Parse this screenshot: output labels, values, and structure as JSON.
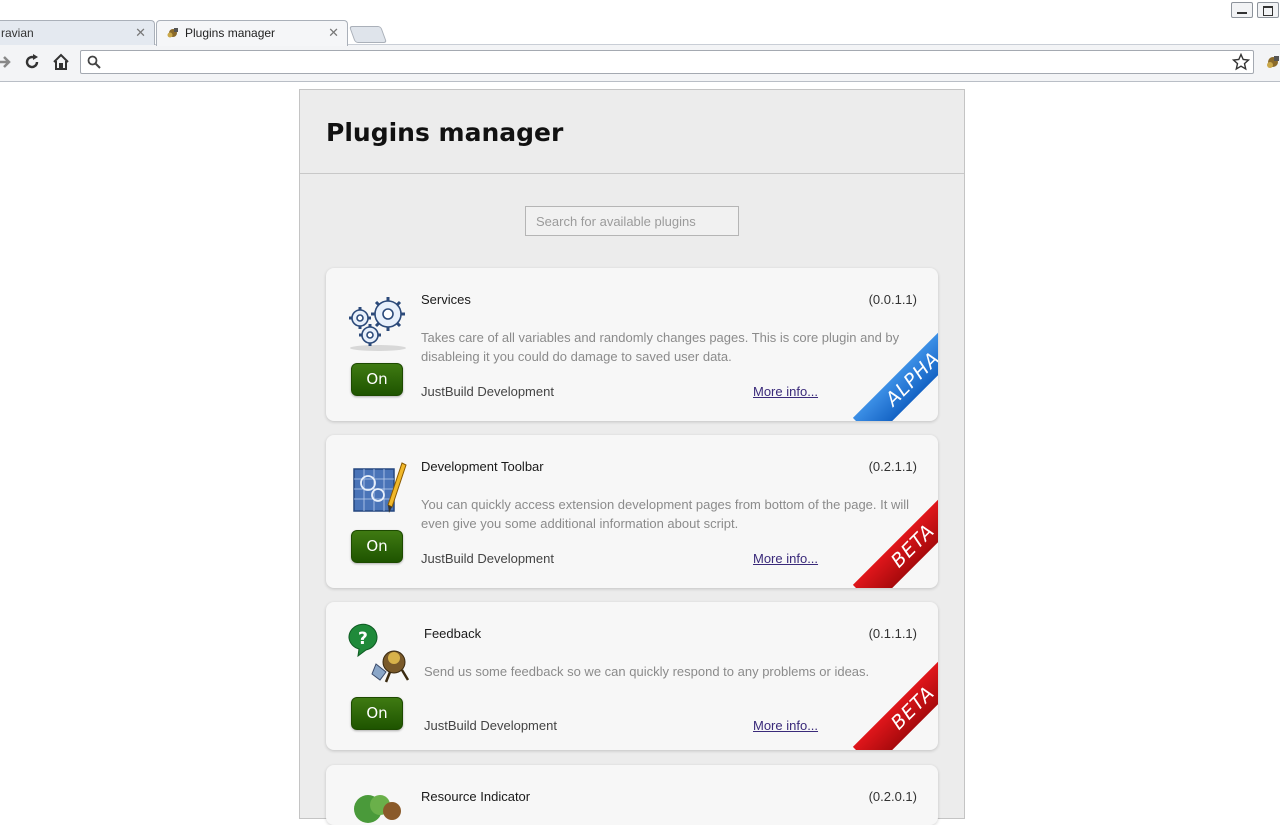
{
  "browser": {
    "tabs": [
      {
        "title": "ravian",
        "active": false
      },
      {
        "title": "Plugins manager",
        "active": true
      }
    ],
    "omnibox_value": ""
  },
  "page": {
    "title": "Plugins manager",
    "search_placeholder": "Search for available plugins"
  },
  "plugins": [
    {
      "name": "Services",
      "version": "(0.0.1.1)",
      "description": "Takes care of all variables and randomly changes pages. This is core plugin and by disableing it you could do damage to saved user data.",
      "author": "JustBuild Development",
      "more": "More info...",
      "toggle": "On",
      "badge": "ALPHA",
      "icon": "gears-icon"
    },
    {
      "name": "Development Toolbar",
      "version": "(0.2.1.1)",
      "description": "You can quickly access extension development pages from bottom of the page. It will even give you some additional information about script.",
      "author": "JustBuild Development",
      "more": "More info...",
      "toggle": "On",
      "badge": "BETA",
      "icon": "blueprint-pencil-icon"
    },
    {
      "name": "Feedback",
      "version": "(0.1.1.1)",
      "description": "Send us some feedback so we can quickly respond to any problems or ideas.",
      "author": "JustBuild Development",
      "more": "More info...",
      "toggle": "On",
      "badge": "BETA",
      "icon": "question-bubble-icon"
    },
    {
      "name": "Resource Indicator",
      "version": "(0.2.0.1)",
      "icon": "resource-icon"
    }
  ]
}
